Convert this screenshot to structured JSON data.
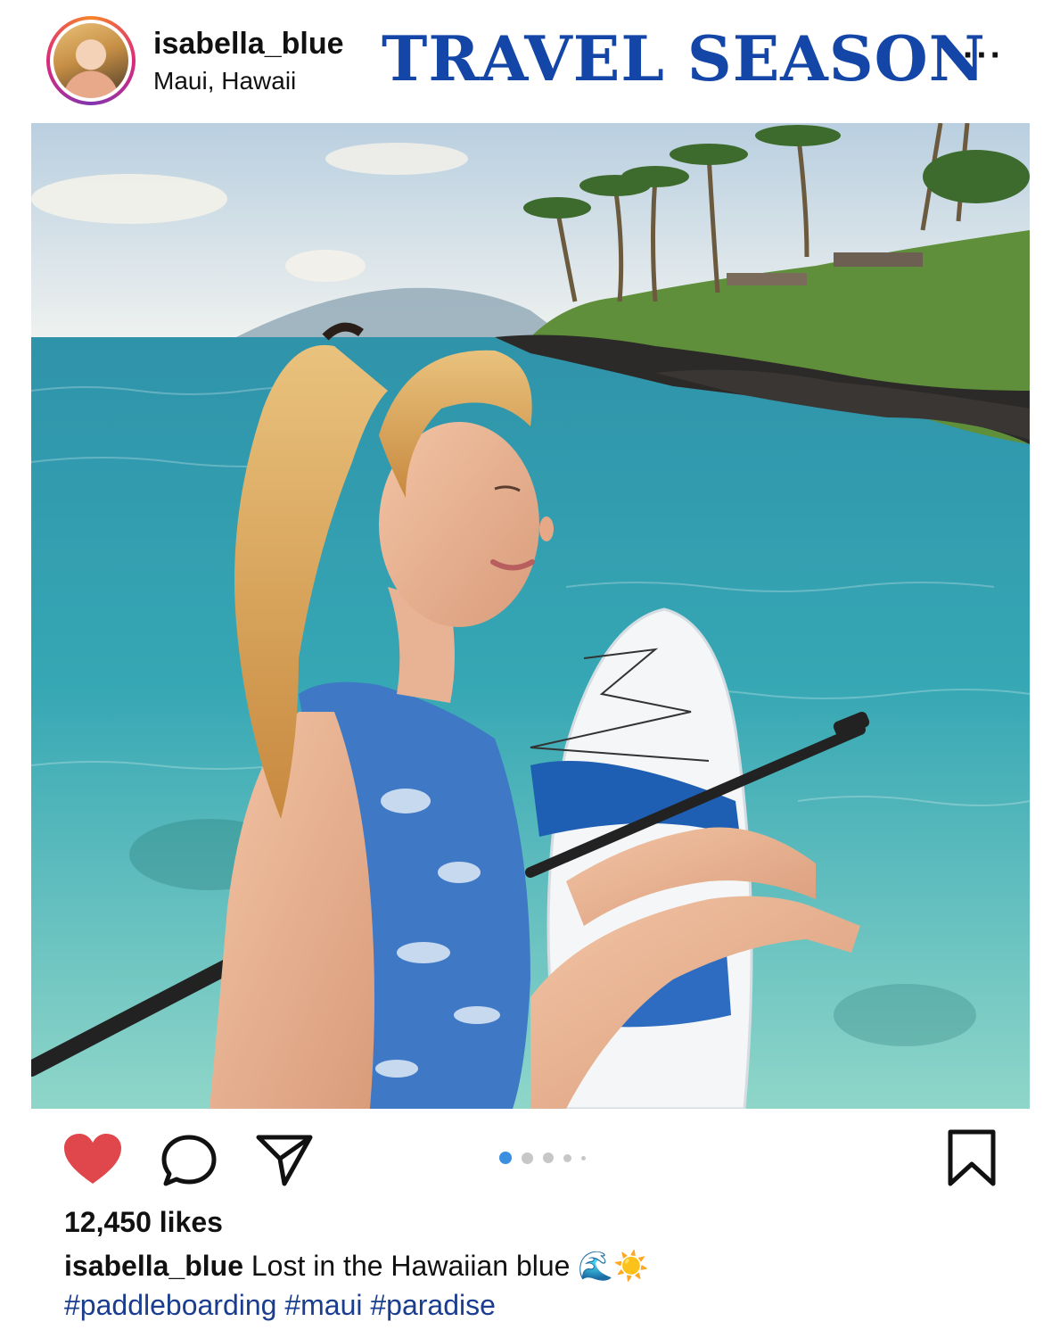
{
  "post": {
    "username": "isabella_blue",
    "location": "Maui, Hawaii",
    "headline": "TRAVEL SEASON",
    "more_label": "···",
    "likes": "12,450 likes",
    "caption_user": "isabella_blue",
    "caption_text": "Lost in the Hawaiian blue 🌊☀️",
    "hashtags": [
      "#paddleboarding",
      "#maui",
      "#paradise"
    ],
    "carousel": {
      "count": 5,
      "active_index": 0
    }
  },
  "icons": [
    "heart-icon",
    "comment-icon",
    "share-icon",
    "bookmark-icon",
    "more-icon"
  ],
  "colors": {
    "headline": "#1446a8",
    "like": "#e0474c",
    "hashtag": "#1a3d8f",
    "active_dot": "#3b8fe0"
  }
}
